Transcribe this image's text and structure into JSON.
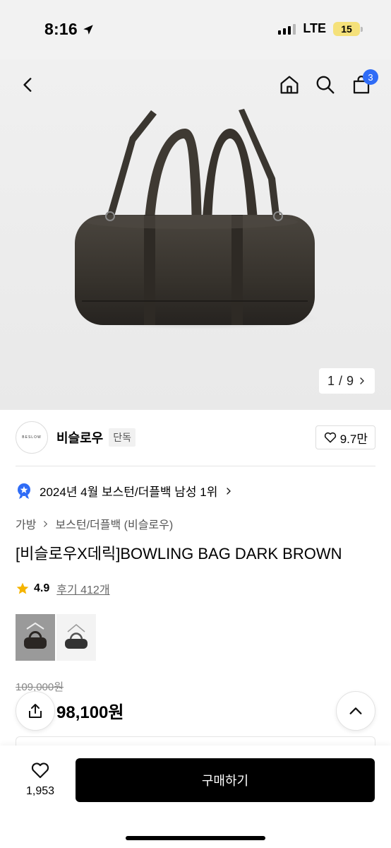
{
  "status_bar": {
    "time": "8:16",
    "network": "LTE",
    "battery": "15"
  },
  "header": {
    "cart_count": "3"
  },
  "gallery": {
    "current": "1",
    "separator": "/",
    "total": "9"
  },
  "brand": {
    "logo_text": "BESLOW",
    "name": "비슬로우",
    "badge": "단독",
    "likes": "9.7만"
  },
  "ranking": {
    "text": "2024년 4월 보스턴/더플백 남성 1위"
  },
  "breadcrumb": {
    "category": "가방",
    "subcategory": "보스턴/더플백 (비슬로우)"
  },
  "product": {
    "title": "[비슬로우X데릭]BOWLING BAG DARK BROWN",
    "rating": "4.9",
    "reviews": "후기 412개",
    "original_price": "109,000원",
    "price": "98,100원"
  },
  "bottom_bar": {
    "wish_count": "1,953",
    "buy_label": "구매하기"
  },
  "colors": {
    "accent": "#2f6cf6",
    "star": "#f5b400",
    "bag": "#3a3630"
  }
}
